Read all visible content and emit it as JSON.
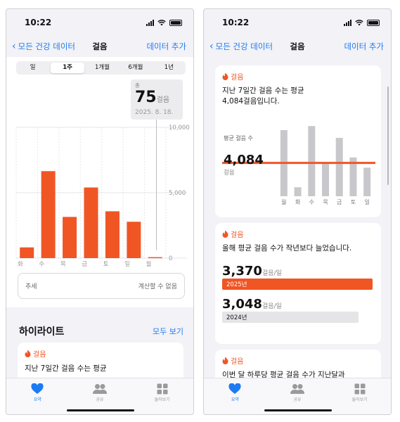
{
  "status": {
    "time": "10:22"
  },
  "left": {
    "nav": {
      "back": "모든 건강 데이터",
      "title": "걸음",
      "add": "데이터 추가"
    },
    "segments": [
      "일",
      "1주",
      "1개월",
      "6개월",
      "1년"
    ],
    "selected_segment": "1주",
    "callout": {
      "label": "총",
      "value": "75",
      "unit": "걸음",
      "date": "2025. 8. 18."
    },
    "chart_data": {
      "type": "bar",
      "categories": [
        "화",
        "수",
        "목",
        "금",
        "토",
        "일",
        "월"
      ],
      "values": [
        820,
        6650,
        3150,
        5400,
        3580,
        2780,
        75
      ],
      "ylim": [
        0,
        10000
      ],
      "ytick_labels": [
        "10,000",
        "5,000",
        "0"
      ],
      "bar_color": "#f05524"
    },
    "trend": {
      "label": "추세",
      "value": "계산할 수 없음"
    },
    "highlights": {
      "title": "하이라이트",
      "link": "모두 보기"
    },
    "highlight_card": {
      "category": "걸음",
      "text": "지난 7일간 걸음 수는 평균"
    }
  },
  "right": {
    "nav": {
      "back": "모든 건강 데이터",
      "title": "걸음",
      "add": "데이터 추가"
    },
    "card1": {
      "category": "걸음",
      "text": "지난 7일간 걸음 수는 평균\n4,084걸음입니다.",
      "avg_label": "평균 걸음 수",
      "avg_value": "4,084",
      "unit": "걸음",
      "chart_data": {
        "type": "bar",
        "categories": [
          "월",
          "화",
          "수",
          "목",
          "금",
          "토",
          "일"
        ],
        "values": [
          8100,
          1100,
          8600,
          4000,
          7150,
          4750,
          3500
        ],
        "average": 4084,
        "ylim": [
          0,
          10000
        ],
        "bar_color": "#c8c8cc",
        "average_color": "#f05524"
      }
    },
    "card2": {
      "category": "걸음",
      "text": "올해 평균 걸음 수가 작년보다 늘었습니다.",
      "chart_data": {
        "type": "bar",
        "categories": [
          "2025년",
          "2024년"
        ],
        "values": [
          3370,
          3048
        ],
        "value_labels": [
          "3,370",
          "3,048"
        ],
        "unit": "걸음/일",
        "colors": [
          "#f05524",
          "#e5e5e8"
        ]
      }
    },
    "card3": {
      "category": "걸음",
      "text": "이번 달 하루당 평균 걸음 수가 지난달과"
    }
  },
  "tabs": [
    "요약",
    "공유",
    "둘러보기"
  ],
  "active_tab": "요약",
  "colors": {
    "accent": "#1e7bf2",
    "steps": "#f05524"
  }
}
